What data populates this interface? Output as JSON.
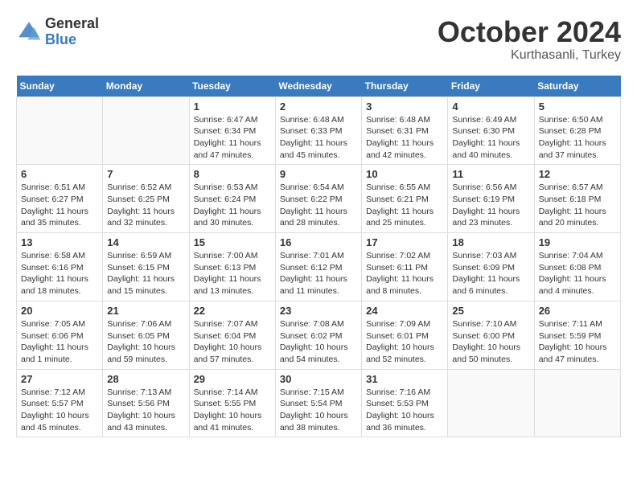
{
  "logo": {
    "general": "General",
    "blue": "Blue"
  },
  "title": "October 2024",
  "location": "Kurthasanli, Turkey",
  "days_header": [
    "Sunday",
    "Monday",
    "Tuesday",
    "Wednesday",
    "Thursday",
    "Friday",
    "Saturday"
  ],
  "weeks": [
    [
      {
        "day": "",
        "sunrise": "",
        "sunset": "",
        "daylight": ""
      },
      {
        "day": "",
        "sunrise": "",
        "sunset": "",
        "daylight": ""
      },
      {
        "day": "1",
        "sunrise": "Sunrise: 6:47 AM",
        "sunset": "Sunset: 6:34 PM",
        "daylight": "Daylight: 11 hours and 47 minutes."
      },
      {
        "day": "2",
        "sunrise": "Sunrise: 6:48 AM",
        "sunset": "Sunset: 6:33 PM",
        "daylight": "Daylight: 11 hours and 45 minutes."
      },
      {
        "day": "3",
        "sunrise": "Sunrise: 6:48 AM",
        "sunset": "Sunset: 6:31 PM",
        "daylight": "Daylight: 11 hours and 42 minutes."
      },
      {
        "day": "4",
        "sunrise": "Sunrise: 6:49 AM",
        "sunset": "Sunset: 6:30 PM",
        "daylight": "Daylight: 11 hours and 40 minutes."
      },
      {
        "day": "5",
        "sunrise": "Sunrise: 6:50 AM",
        "sunset": "Sunset: 6:28 PM",
        "daylight": "Daylight: 11 hours and 37 minutes."
      }
    ],
    [
      {
        "day": "6",
        "sunrise": "Sunrise: 6:51 AM",
        "sunset": "Sunset: 6:27 PM",
        "daylight": "Daylight: 11 hours and 35 minutes."
      },
      {
        "day": "7",
        "sunrise": "Sunrise: 6:52 AM",
        "sunset": "Sunset: 6:25 PM",
        "daylight": "Daylight: 11 hours and 32 minutes."
      },
      {
        "day": "8",
        "sunrise": "Sunrise: 6:53 AM",
        "sunset": "Sunset: 6:24 PM",
        "daylight": "Daylight: 11 hours and 30 minutes."
      },
      {
        "day": "9",
        "sunrise": "Sunrise: 6:54 AM",
        "sunset": "Sunset: 6:22 PM",
        "daylight": "Daylight: 11 hours and 28 minutes."
      },
      {
        "day": "10",
        "sunrise": "Sunrise: 6:55 AM",
        "sunset": "Sunset: 6:21 PM",
        "daylight": "Daylight: 11 hours and 25 minutes."
      },
      {
        "day": "11",
        "sunrise": "Sunrise: 6:56 AM",
        "sunset": "Sunset: 6:19 PM",
        "daylight": "Daylight: 11 hours and 23 minutes."
      },
      {
        "day": "12",
        "sunrise": "Sunrise: 6:57 AM",
        "sunset": "Sunset: 6:18 PM",
        "daylight": "Daylight: 11 hours and 20 minutes."
      }
    ],
    [
      {
        "day": "13",
        "sunrise": "Sunrise: 6:58 AM",
        "sunset": "Sunset: 6:16 PM",
        "daylight": "Daylight: 11 hours and 18 minutes."
      },
      {
        "day": "14",
        "sunrise": "Sunrise: 6:59 AM",
        "sunset": "Sunset: 6:15 PM",
        "daylight": "Daylight: 11 hours and 15 minutes."
      },
      {
        "day": "15",
        "sunrise": "Sunrise: 7:00 AM",
        "sunset": "Sunset: 6:13 PM",
        "daylight": "Daylight: 11 hours and 13 minutes."
      },
      {
        "day": "16",
        "sunrise": "Sunrise: 7:01 AM",
        "sunset": "Sunset: 6:12 PM",
        "daylight": "Daylight: 11 hours and 11 minutes."
      },
      {
        "day": "17",
        "sunrise": "Sunrise: 7:02 AM",
        "sunset": "Sunset: 6:11 PM",
        "daylight": "Daylight: 11 hours and 8 minutes."
      },
      {
        "day": "18",
        "sunrise": "Sunrise: 7:03 AM",
        "sunset": "Sunset: 6:09 PM",
        "daylight": "Daylight: 11 hours and 6 minutes."
      },
      {
        "day": "19",
        "sunrise": "Sunrise: 7:04 AM",
        "sunset": "Sunset: 6:08 PM",
        "daylight": "Daylight: 11 hours and 4 minutes."
      }
    ],
    [
      {
        "day": "20",
        "sunrise": "Sunrise: 7:05 AM",
        "sunset": "Sunset: 6:06 PM",
        "daylight": "Daylight: 11 hours and 1 minute."
      },
      {
        "day": "21",
        "sunrise": "Sunrise: 7:06 AM",
        "sunset": "Sunset: 6:05 PM",
        "daylight": "Daylight: 10 hours and 59 minutes."
      },
      {
        "day": "22",
        "sunrise": "Sunrise: 7:07 AM",
        "sunset": "Sunset: 6:04 PM",
        "daylight": "Daylight: 10 hours and 57 minutes."
      },
      {
        "day": "23",
        "sunrise": "Sunrise: 7:08 AM",
        "sunset": "Sunset: 6:02 PM",
        "daylight": "Daylight: 10 hours and 54 minutes."
      },
      {
        "day": "24",
        "sunrise": "Sunrise: 7:09 AM",
        "sunset": "Sunset: 6:01 PM",
        "daylight": "Daylight: 10 hours and 52 minutes."
      },
      {
        "day": "25",
        "sunrise": "Sunrise: 7:10 AM",
        "sunset": "Sunset: 6:00 PM",
        "daylight": "Daylight: 10 hours and 50 minutes."
      },
      {
        "day": "26",
        "sunrise": "Sunrise: 7:11 AM",
        "sunset": "Sunset: 5:59 PM",
        "daylight": "Daylight: 10 hours and 47 minutes."
      }
    ],
    [
      {
        "day": "27",
        "sunrise": "Sunrise: 7:12 AM",
        "sunset": "Sunset: 5:57 PM",
        "daylight": "Daylight: 10 hours and 45 minutes."
      },
      {
        "day": "28",
        "sunrise": "Sunrise: 7:13 AM",
        "sunset": "Sunset: 5:56 PM",
        "daylight": "Daylight: 10 hours and 43 minutes."
      },
      {
        "day": "29",
        "sunrise": "Sunrise: 7:14 AM",
        "sunset": "Sunset: 5:55 PM",
        "daylight": "Daylight: 10 hours and 41 minutes."
      },
      {
        "day": "30",
        "sunrise": "Sunrise: 7:15 AM",
        "sunset": "Sunset: 5:54 PM",
        "daylight": "Daylight: 10 hours and 38 minutes."
      },
      {
        "day": "31",
        "sunrise": "Sunrise: 7:16 AM",
        "sunset": "Sunset: 5:53 PM",
        "daylight": "Daylight: 10 hours and 36 minutes."
      },
      {
        "day": "",
        "sunrise": "",
        "sunset": "",
        "daylight": ""
      },
      {
        "day": "",
        "sunrise": "",
        "sunset": "",
        "daylight": ""
      }
    ]
  ]
}
